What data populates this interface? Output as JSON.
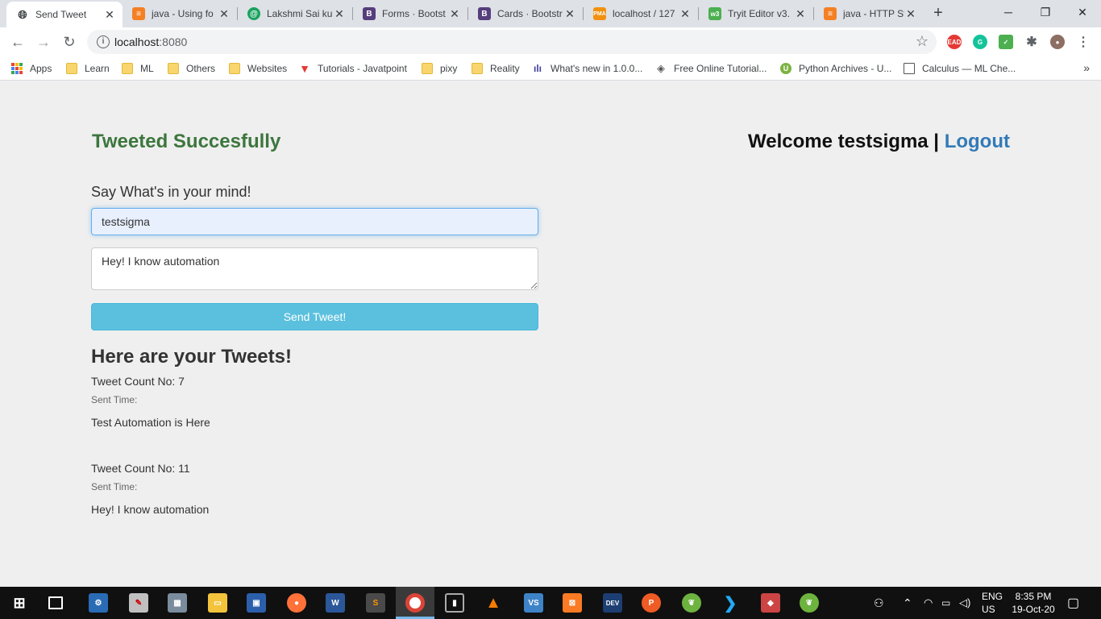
{
  "browser": {
    "tabs": [
      {
        "title": "Send Tweet",
        "active": true,
        "icon": "globe-icon",
        "color": "#3c4043"
      },
      {
        "title": "java - Using fo",
        "active": false,
        "icon": "stackoverflow-icon",
        "color": "#f48024"
      },
      {
        "title": "Lakshmi Sai ku",
        "active": false,
        "icon": "at-icon",
        "color": "#1aa260"
      },
      {
        "title": "Forms · Bootst",
        "active": false,
        "icon": "bootstrap-icon",
        "color": "#563d7c"
      },
      {
        "title": "Cards · Bootstr",
        "active": false,
        "icon": "bootstrap-icon",
        "color": "#563d7c"
      },
      {
        "title": "localhost / 127",
        "active": false,
        "icon": "phpmyadmin-icon",
        "color": "#f29111"
      },
      {
        "title": "Tryit Editor v3.",
        "active": false,
        "icon": "w3schools-icon",
        "color": "#4caf50"
      },
      {
        "title": "java - HTTP Sta",
        "active": false,
        "icon": "stackoverflow-icon",
        "color": "#f48024"
      }
    ],
    "url": "localhost",
    "port": ":8080",
    "bookmarks": [
      {
        "label": "Apps",
        "icon": "apps-icon"
      },
      {
        "label": "Learn",
        "icon": "folder-icon"
      },
      {
        "label": "ML",
        "icon": "folder-icon"
      },
      {
        "label": "Others",
        "icon": "folder-icon"
      },
      {
        "label": "Websites",
        "icon": "folder-icon"
      },
      {
        "label": "Tutorials - Javatpoint",
        "icon": "javatpoint-icon"
      },
      {
        "label": "pixy",
        "icon": "folder-icon"
      },
      {
        "label": "Reality",
        "icon": "folder-icon"
      },
      {
        "label": "What's new in 1.0.0...",
        "icon": "chart-icon"
      },
      {
        "label": "Free Online Tutorial...",
        "icon": "diamond-icon"
      },
      {
        "label": "Python Archives - U...",
        "icon": "udemy-icon"
      },
      {
        "label": "Calculus — ML Che...",
        "icon": "doc-icon"
      }
    ]
  },
  "page": {
    "status_message": "Tweeted Succesfully",
    "welcome_prefix": "Welcome testsigma |",
    "logout_label": "Logout",
    "prompt": "Say What's in your mind!",
    "username_value": "testsigma",
    "tweet_value": "Hey! I know automation",
    "send_label": "Send Tweet!",
    "tweets_heading": "Here are your Tweets!",
    "tweets": [
      {
        "count": "Tweet Count No: 7",
        "sent": "Sent Time:",
        "message": "Test Automation is Here"
      },
      {
        "count": "Tweet Count No: 11",
        "sent": "Sent Time:",
        "message": "Hey! I know automation"
      }
    ]
  },
  "taskbar": {
    "apps": [
      "start-icon",
      "task-view-icon",
      "network-icon",
      "paint-icon",
      "photos-icon",
      "file-explorer-icon",
      "device-icon",
      "firefox-icon",
      "word-icon",
      "sublime-icon",
      "chrome-icon",
      "pycharm-icon",
      "vlc-icon",
      "visual-studio-icon",
      "xampp-icon",
      "dev-cpp-icon",
      "postman-icon",
      "spring-icon",
      "vscode-icon",
      "virtualbox-icon",
      "spring-tool-icon"
    ],
    "lang_top": "ENG",
    "lang_bottom": "US",
    "time": "8:35 PM",
    "date": "19-Oct-20"
  },
  "colors": {
    "success_text": "#3c763d",
    "link": "#337ab7",
    "send_button": "#5bc0de"
  }
}
